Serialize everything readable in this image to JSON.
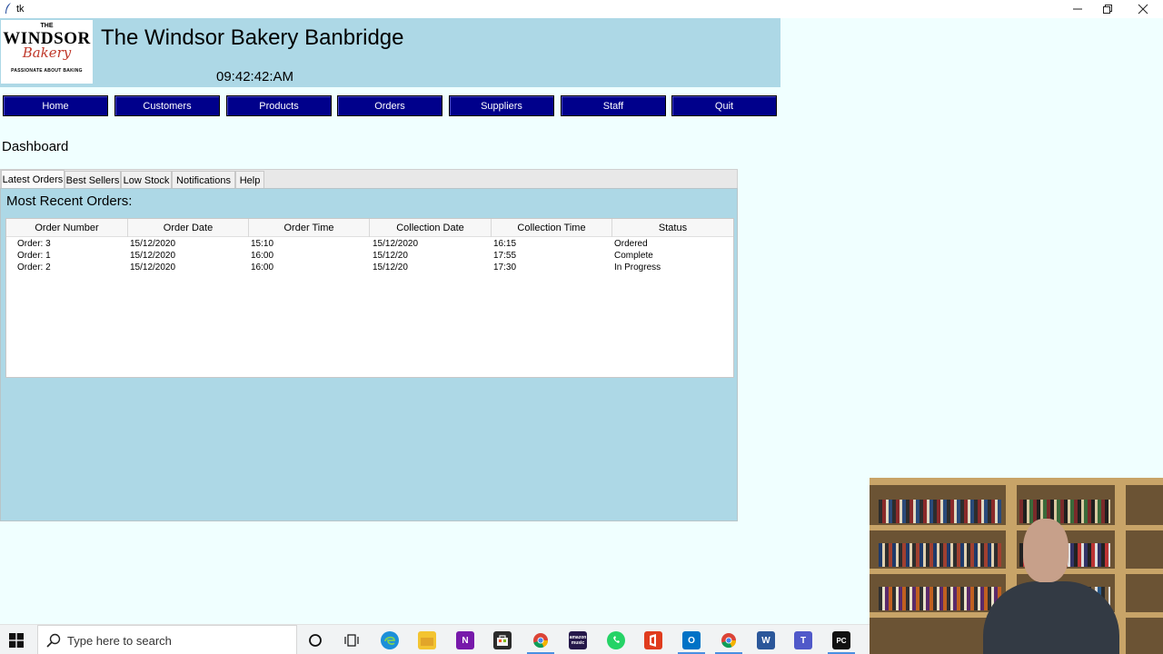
{
  "window": {
    "title": "tk",
    "controls": [
      "minimize-icon",
      "restore-icon",
      "close-icon"
    ]
  },
  "header": {
    "logo": {
      "the": "THE",
      "windsor": "WINDSOR",
      "bakery": "Bakery",
      "tagline": "PASSIONATE ABOUT BAKING"
    },
    "title": "The Windsor Bakery Banbridge",
    "clock": "09:42:42:AM"
  },
  "nav": {
    "home": "Home",
    "customers": "Customers",
    "products": "Products",
    "orders": "Orders",
    "suppliers": "Suppliers",
    "staff": "Staff",
    "quit": "Quit"
  },
  "page_title": "Dashboard",
  "tabs": {
    "latest_orders": "Latest Orders",
    "best_sellers": "Best Sellers",
    "low_stock": "Low Stock",
    "notifications": "Notifications",
    "help": "Help",
    "active": "Latest Orders"
  },
  "latest_orders": {
    "heading": "Most Recent Orders:",
    "columns": [
      "Order Number",
      "Order Date",
      "Order Time",
      "Collection Date",
      "Collection Time",
      "Status"
    ],
    "rows": [
      [
        "Order: 3",
        "15/12/2020",
        "15:10",
        "15/12/2020",
        "16:15",
        "Ordered"
      ],
      [
        "Order: 1",
        "15/12/2020",
        "16:00",
        "15/12/20",
        "17:55",
        "Complete"
      ],
      [
        "Order: 2",
        "15/12/2020",
        "16:00",
        "15/12/20",
        "17:30",
        "In Progress"
      ]
    ]
  },
  "taskbar": {
    "search_placeholder": "Type here to search",
    "icons": [
      "windows-start-icon",
      "cortana-icon",
      "task-view-icon",
      "edge-icon",
      "file-explorer-icon",
      "onenote-icon",
      "store-icon",
      "chrome-icon",
      "amazon-music-icon",
      "whatsapp-icon",
      "office-icon",
      "outlook-icon",
      "chrome-icon",
      "word-icon",
      "teams-icon",
      "pycharm-icon"
    ],
    "amazon_music_label": "amazon music",
    "onenote_letter": "N",
    "word_letter": "W",
    "teams_letter": "T",
    "pycharm_letters": "PC",
    "outlook_letter": "O"
  },
  "colors": {
    "header_bg": "#add8e6",
    "nav_button_bg": "#00008b",
    "window_bg": "#f0ffff"
  }
}
